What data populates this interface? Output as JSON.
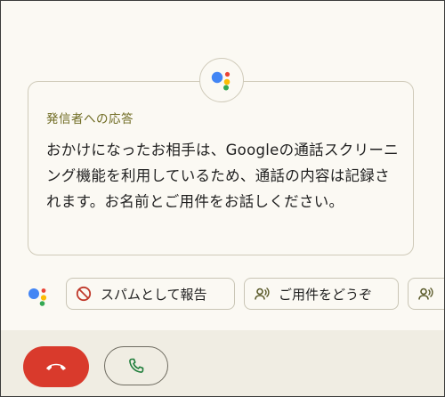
{
  "screening_card": {
    "title": "発信者への応答",
    "message": "おかけになったお相手は、Googleの通話スクリーニング機能を利用しているため、通話の内容は記録されます。お名前とご用件をお話しください。"
  },
  "quick_replies": [
    {
      "label": "スパムとして報告",
      "icon": "block-icon"
    },
    {
      "label": "ご用件をどうぞ",
      "icon": "voice-prompt-icon"
    },
    {
      "label": "",
      "icon": "voice-prompt-icon"
    }
  ],
  "call_controls": {
    "decline_icon": "hang-up-icon",
    "accept_icon": "phone-icon"
  },
  "colors": {
    "background": "#fbf9f3",
    "title": "#6f6b22",
    "decline": "#d93a2c",
    "accept_icon": "#1e7d3a",
    "google_blue": "#4285f4",
    "google_red": "#ea4335",
    "google_yellow": "#fbbc05",
    "google_green": "#34a853"
  }
}
